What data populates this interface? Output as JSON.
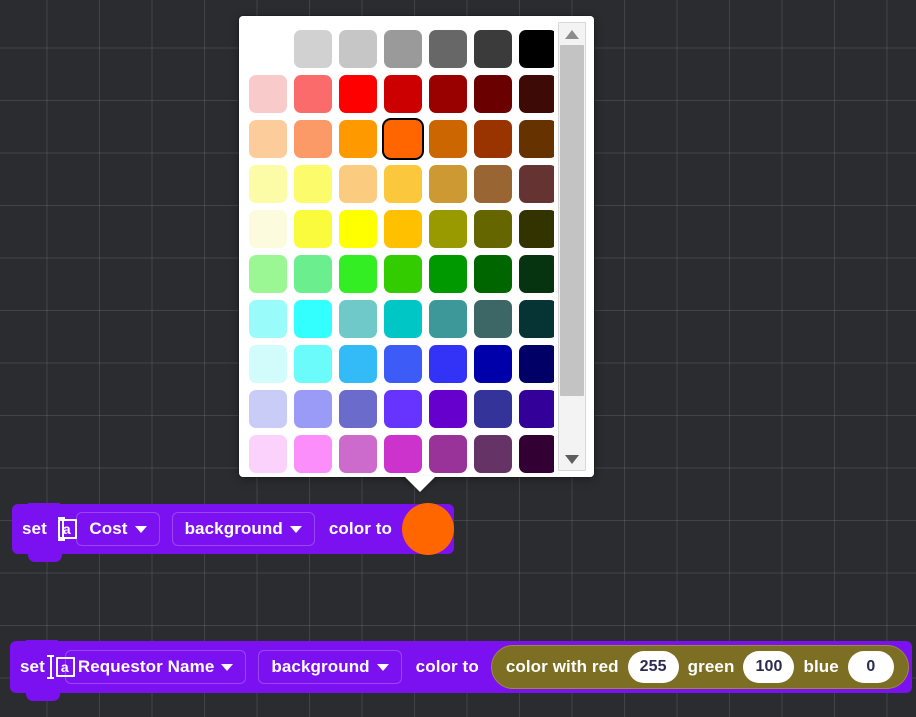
{
  "canvas": {
    "background_color": "#2b2c2f",
    "grid_line_color": "rgba(255,255,255,0.11)"
  },
  "color_picker": {
    "name": "color-palette-popup",
    "selected_color": "#FF6600",
    "selected_index": 17,
    "columns": 7,
    "rows_visible": 10,
    "scrollbar": {
      "up_arrow": "scroll-up-arrow",
      "down_arrow": "scroll-down-arrow",
      "thumb_position_percent": 0
    },
    "swatches": [
      "#FFFFFF",
      "#D1D1D1",
      "#C6C6C6",
      "#9A9A9A",
      "#676767",
      "#3B3B3B",
      "#000000",
      "#F9CACA",
      "#FB6B6B",
      "#FF0000",
      "#CC0000",
      "#990000",
      "#6B0000",
      "#3D0A05",
      "#FCCC9A",
      "#FB9A66",
      "#FF9900",
      "#FF6600",
      "#CC6600",
      "#993300",
      "#663300",
      "#FCFCA7",
      "#FBFB6B",
      "#FBCC80",
      "#FBC73D",
      "#CC9933",
      "#996633",
      "#663333",
      "#FDFBDD",
      "#FBFB3D",
      "#FFFF00",
      "#FFC000",
      "#999900",
      "#666600",
      "#333300",
      "#9BF793",
      "#6BEF8E",
      "#33EE22",
      "#33CC00",
      "#009900",
      "#006600",
      "#063310",
      "#9AFBFB",
      "#33FFFF",
      "#70C9C9",
      "#00C6C6",
      "#3D9999",
      "#3D6666",
      "#063333",
      "#D2FBFB",
      "#6BFBFB",
      "#33BBF7",
      "#3D5CF7",
      "#3333F7",
      "#0000AA",
      "#000066",
      "#C8CCF7",
      "#9A9AF7",
      "#6B6BCC",
      "#6633FF",
      "#6600CC",
      "#333399",
      "#330099",
      "#FBD2FB",
      "#FB8EFB",
      "#CC6BCC",
      "#CC33CC",
      "#993399",
      "#663366",
      "#330033"
    ]
  },
  "blocks": [
    {
      "name": "set-variable-background-color-swatch",
      "set_label": "set",
      "variable_icon": "text-variable-icon",
      "variable_icon_letter": "a",
      "variable_name": "Cost",
      "property_name": "background",
      "color_to_label": "color to",
      "color_value": "#FF6600",
      "block_color": "#7B11F0"
    },
    {
      "name": "set-variable-background-color-rgb",
      "set_label": "set",
      "variable_icon": "text-variable-icon",
      "variable_icon_letter": "a",
      "variable_name": "Requestor Name",
      "property_name": "background",
      "color_to_label": "color to",
      "block_color": "#7B11F0",
      "reporter": {
        "name": "color-with-rgb-reporter",
        "prefix_label": "color with red",
        "red": "255",
        "green_label": "green",
        "green": "100",
        "blue_label": "blue",
        "blue": "0",
        "reporter_color": "#7C6F23"
      }
    }
  ]
}
